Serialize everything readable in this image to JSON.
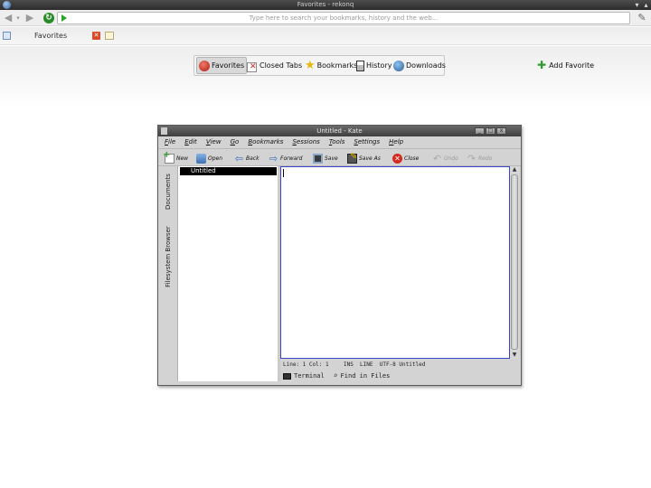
{
  "window": {
    "title": "Favorites - rekonq"
  },
  "nav": {
    "url_placeholder": "Type here to search your bookmarks, history and the web..."
  },
  "tabs": [
    {
      "label": "Favorites"
    }
  ],
  "rekonq_toolbar": {
    "items": [
      {
        "label": "Favorites",
        "icon": "heart-icon",
        "active": true
      },
      {
        "label": "Closed Tabs",
        "icon": "closed-tabs-icon"
      },
      {
        "label": "Bookmarks",
        "icon": "star-icon"
      },
      {
        "label": "History",
        "icon": "history-icon"
      },
      {
        "label": "Downloads",
        "icon": "downloads-icon"
      }
    ],
    "add_favorite": "Add Favorite"
  },
  "kate": {
    "title": "Untitled - Kate",
    "menu": [
      "File",
      "Edit",
      "View",
      "Go",
      "Bookmarks",
      "Sessions",
      "Tools",
      "Settings",
      "Help"
    ],
    "toolbar": [
      "New",
      "Open",
      "Back",
      "Forward",
      "Save",
      "Save As",
      "Close",
      "Undo",
      "Redo"
    ],
    "side_tabs": [
      "Documents",
      "Filesystem Browser"
    ],
    "documents": [
      "Untitled"
    ],
    "status": {
      "position": "Line: 1 Col: 1",
      "mode": "INS  LINE  UTF-8 Untitled"
    },
    "bottom_tabs": [
      "Terminal",
      "Find in Files"
    ]
  }
}
